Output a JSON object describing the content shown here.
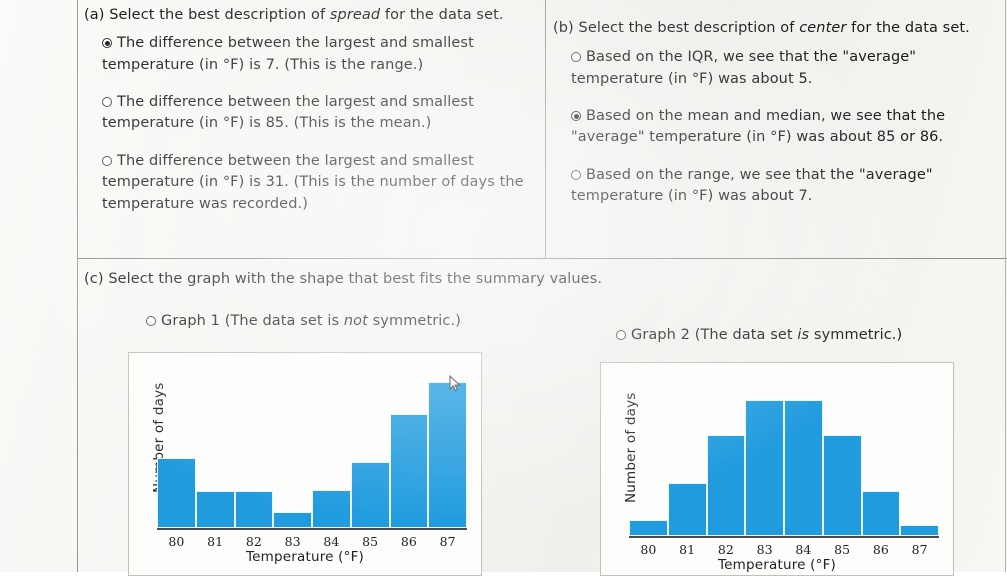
{
  "part_a": {
    "label": "(a)",
    "prompt_pre": "Select the best description of ",
    "prompt_italic": "spread",
    "prompt_post": " for the data set.",
    "options": [
      {
        "text": "The difference between the largest and smallest temperature (in °F) is 7. (This is the range.)",
        "selected": true
      },
      {
        "text": "The difference between the largest and smallest temperature (in °F) is 85. (This is the mean.)",
        "selected": false
      },
      {
        "text": "The difference between the largest and smallest temperature (in °F) is 31. (This is the number of days the temperature was recorded.)",
        "selected": false
      }
    ]
  },
  "part_b": {
    "label": "(b)",
    "prompt_pre": "Select the best description of ",
    "prompt_italic": "center",
    "prompt_post": " for the data set.",
    "options": [
      {
        "text": "Based on the IQR, we see that the \"average\" temperature (in °F) was about 5.",
        "selected": false
      },
      {
        "text": "Based on the mean and median, we see that the \"average\" temperature (in °F) was about 85 or 86.",
        "selected": true
      },
      {
        "text": "Based on the range, we see that the \"average\" temperature (in °F) was about 7.",
        "selected": false
      }
    ]
  },
  "part_c": {
    "label": "(c)",
    "prompt": "Select the graph with the shape that best fits the summary values.",
    "choices": [
      {
        "pre": "Graph 1 (The data set is ",
        "italic": "not",
        "post": " symmetric.)",
        "selected": false
      },
      {
        "pre": "Graph 2 (The data set ",
        "italic": "is",
        "post": " symmetric.)",
        "selected": false
      }
    ]
  },
  "chart_data": [
    {
      "type": "bar",
      "name": "Graph 1",
      "title": "",
      "categories": [
        "80",
        "81",
        "82",
        "83",
        "84",
        "85",
        "86",
        "87"
      ],
      "values": [
        4.4,
        2.3,
        2.3,
        1.0,
        2.4,
        4.1,
        7.1,
        9.1
      ],
      "xlabel": "Temperature (°F)",
      "ylabel": "Number of days",
      "ylim": [
        0,
        10
      ],
      "grid": false,
      "legend": "none",
      "bar_color": "#1f9bde"
    },
    {
      "type": "bar",
      "name": "Graph 2",
      "title": "",
      "categories": [
        "80",
        "81",
        "82",
        "83",
        "84",
        "85",
        "86",
        "87"
      ],
      "values": [
        1.0,
        3.3,
        6.3,
        8.5,
        8.5,
        6.3,
        2.8,
        0.7
      ],
      "xlabel": "Temperature (°F)",
      "ylabel": "Number of days",
      "ylim": [
        0,
        10
      ],
      "grid": false,
      "legend": "none",
      "bar_color": "#1f9bde"
    }
  ]
}
